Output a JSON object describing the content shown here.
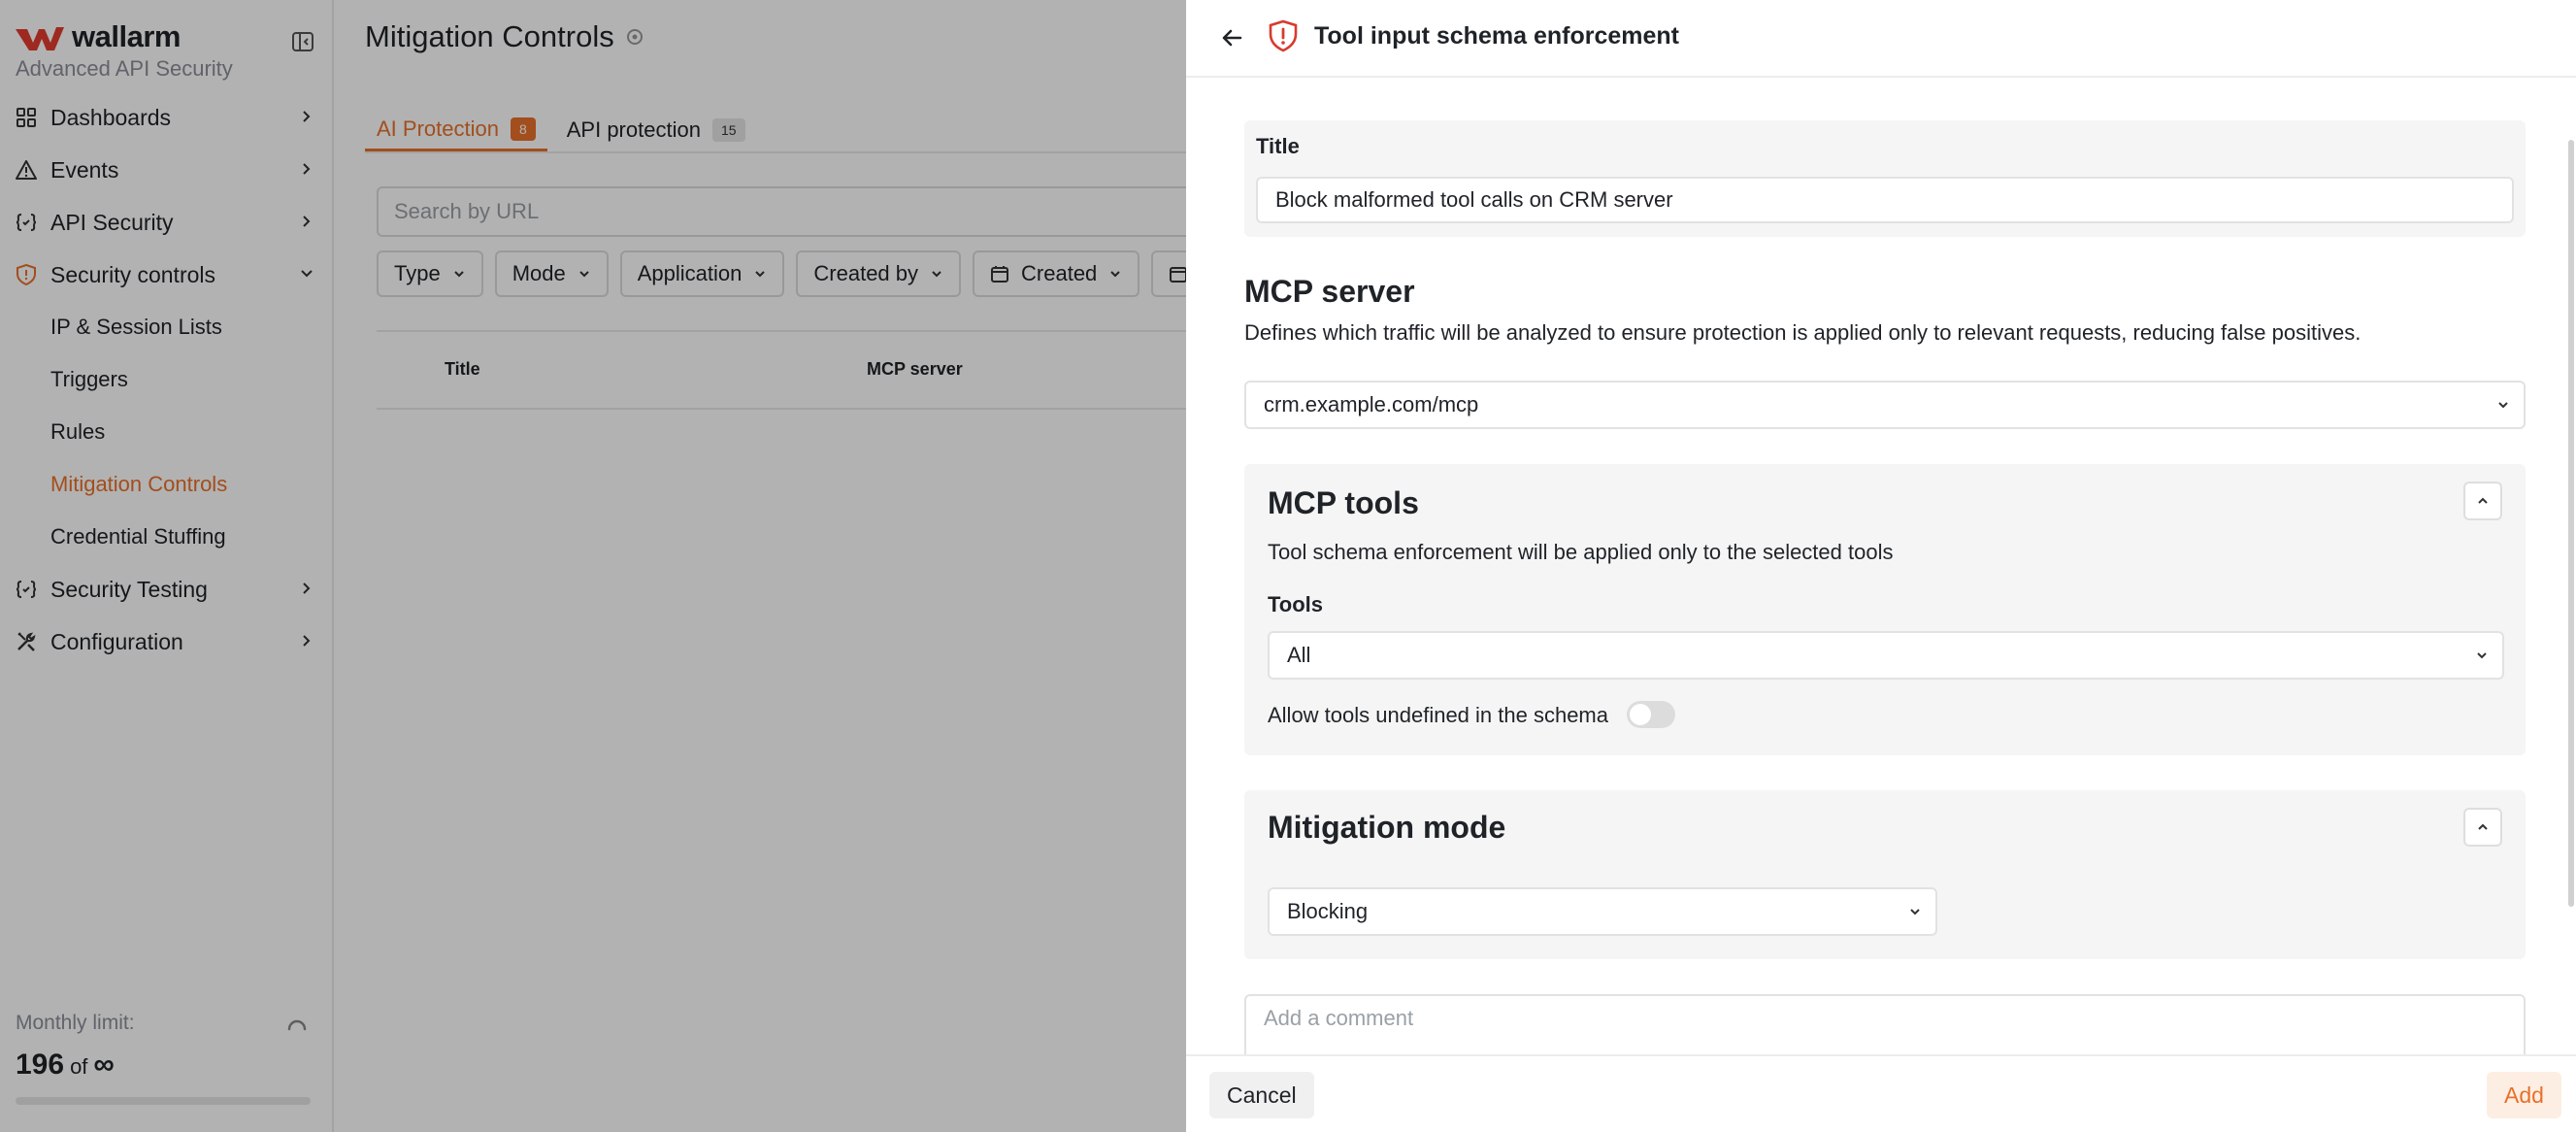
{
  "app": {
    "logo_text": "wallarm",
    "subtitle": "Advanced API Security"
  },
  "sidebar": {
    "items": [
      {
        "label": "Dashboards",
        "icon": "grid-icon"
      },
      {
        "label": "Events",
        "icon": "warning-icon"
      },
      {
        "label": "API Security",
        "icon": "code-braces-icon"
      },
      {
        "label": "Security controls",
        "icon": "shield-icon",
        "expanded": true
      },
      {
        "label": "Security Testing",
        "icon": "code-braces-icon"
      },
      {
        "label": "Configuration",
        "icon": "tools-icon"
      }
    ],
    "subitems": [
      {
        "label": "IP & Session Lists"
      },
      {
        "label": "Triggers"
      },
      {
        "label": "Rules"
      },
      {
        "label": "Mitigation Controls",
        "active": true
      },
      {
        "label": "Credential Stuffing"
      }
    ],
    "limit": {
      "label": "Monthly limit:",
      "used": "196",
      "of": "of",
      "total": "∞",
      "progress_fraction": 0
    }
  },
  "main": {
    "title": "Mitigation Controls",
    "tabs": [
      {
        "label": "AI Protection",
        "count": "8",
        "active": true
      },
      {
        "label": "API protection",
        "count": "15",
        "active": false
      }
    ],
    "search_placeholder": "Search by URL",
    "filters": [
      {
        "label": "Type"
      },
      {
        "label": "Mode"
      },
      {
        "label": "Application"
      },
      {
        "label": "Created by"
      },
      {
        "label": "Created",
        "icon": "calendar-icon"
      }
    ],
    "table_headers": [
      "Title",
      "MCP server"
    ]
  },
  "drawer": {
    "title": "Tool input schema enforcement",
    "title_field": {
      "label": "Title",
      "value": "Block malformed tool calls on CRM server"
    },
    "mcp_server": {
      "title": "MCP server",
      "description": "Defines which traffic will be analyzed to ensure protection is applied only to relevant requests, reducing false positives.",
      "value": "crm.example.com/mcp"
    },
    "mcp_tools": {
      "title": "MCP tools",
      "description": "Tool schema enforcement will be applied only to the selected tools",
      "tools_label": "Tools",
      "tools_value": "All",
      "allow_label": "Allow tools undefined in the schema",
      "allow_enabled": false
    },
    "mitigation": {
      "title": "Mitigation mode",
      "value": "Blocking"
    },
    "comment_placeholder": "Add a comment",
    "cancel_label": "Cancel",
    "add_label": "Add"
  },
  "colors": {
    "accent": "#e8702a",
    "danger": "#d83a2f"
  }
}
